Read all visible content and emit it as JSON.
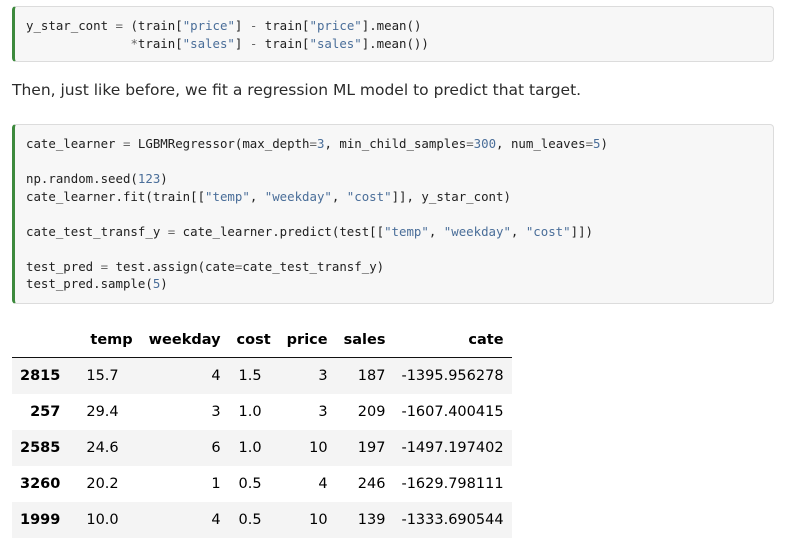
{
  "cell1": {
    "lines": [
      [
        [
          "y_star_cont ",
          ""
        ],
        [
          "=",
          "op"
        ],
        [
          " (train[",
          ""
        ],
        [
          "\"price\"",
          "str"
        ],
        [
          "] ",
          ""
        ],
        [
          "-",
          "op"
        ],
        [
          " train[",
          ""
        ],
        [
          "\"price\"",
          "str"
        ],
        [
          "].mean()",
          ""
        ]
      ],
      [
        [
          "              ",
          ""
        ],
        [
          "*",
          "op"
        ],
        [
          "train[",
          ""
        ],
        [
          "\"sales\"",
          "str"
        ],
        [
          "] ",
          ""
        ],
        [
          "-",
          "op"
        ],
        [
          " train[",
          ""
        ],
        [
          "\"sales\"",
          "str"
        ],
        [
          "].mean())",
          ""
        ]
      ]
    ]
  },
  "prose": {
    "text": "Then, just like before, we fit a regression ML model to predict that target."
  },
  "cell2": {
    "lines": [
      [
        [
          "cate_learner ",
          ""
        ],
        [
          "=",
          "op"
        ],
        [
          " LGBMRegressor(max_depth",
          ""
        ],
        [
          "=",
          "op"
        ],
        [
          "3",
          "num"
        ],
        [
          ", min_child_samples",
          ""
        ],
        [
          "=",
          "op"
        ],
        [
          "300",
          "num"
        ],
        [
          ", num_leaves",
          ""
        ],
        [
          "=",
          "op"
        ],
        [
          "5",
          "num"
        ],
        [
          ")",
          ""
        ]
      ],
      [],
      [
        [
          "np.random.seed(",
          ""
        ],
        [
          "123",
          "num"
        ],
        [
          ")",
          ""
        ]
      ],
      [
        [
          "cate_learner.fit(train[[",
          ""
        ],
        [
          "\"temp\"",
          "str"
        ],
        [
          ", ",
          ""
        ],
        [
          "\"weekday\"",
          "str"
        ],
        [
          ", ",
          ""
        ],
        [
          "\"cost\"",
          "str"
        ],
        [
          "]], y_star_cont)",
          ""
        ]
      ],
      [],
      [
        [
          "cate_test_transf_y ",
          ""
        ],
        [
          "=",
          "op"
        ],
        [
          " cate_learner.predict(test[[",
          ""
        ],
        [
          "\"temp\"",
          "str"
        ],
        [
          ", ",
          ""
        ],
        [
          "\"weekday\"",
          "str"
        ],
        [
          ", ",
          ""
        ],
        [
          "\"cost\"",
          "str"
        ],
        [
          "]])",
          ""
        ]
      ],
      [],
      [
        [
          "test_pred ",
          ""
        ],
        [
          "=",
          "op"
        ],
        [
          " test.assign(cate",
          ""
        ],
        [
          "=",
          "op"
        ],
        [
          "cate_test_transf_y)",
          ""
        ]
      ],
      [
        [
          "test_pred.sample(",
          ""
        ],
        [
          "5",
          "num"
        ],
        [
          ")",
          ""
        ]
      ]
    ]
  },
  "table": {
    "columns": [
      "temp",
      "weekday",
      "cost",
      "price",
      "sales",
      "cate"
    ],
    "rows": [
      {
        "index": "2815",
        "temp": "15.7",
        "weekday": "4",
        "cost": "1.5",
        "price": "3",
        "sales": "187",
        "cate": "-1395.956278"
      },
      {
        "index": "257",
        "temp": "29.4",
        "weekday": "3",
        "cost": "1.0",
        "price": "3",
        "sales": "209",
        "cate": "-1607.400415"
      },
      {
        "index": "2585",
        "temp": "24.6",
        "weekday": "6",
        "cost": "1.0",
        "price": "10",
        "sales": "197",
        "cate": "-1497.197402"
      },
      {
        "index": "3260",
        "temp": "20.2",
        "weekday": "1",
        "cost": "0.5",
        "price": "4",
        "sales": "246",
        "cate": "-1629.798111"
      },
      {
        "index": "1999",
        "temp": "10.0",
        "weekday": "4",
        "cost": "0.5",
        "price": "10",
        "sales": "139",
        "cate": "-1333.690544"
      }
    ]
  },
  "colors": {
    "cell_accent": "#3d8a3d",
    "string_token": "#4a6e99",
    "operator_token": "#666666",
    "row_stripe": "#f4f4f4"
  }
}
